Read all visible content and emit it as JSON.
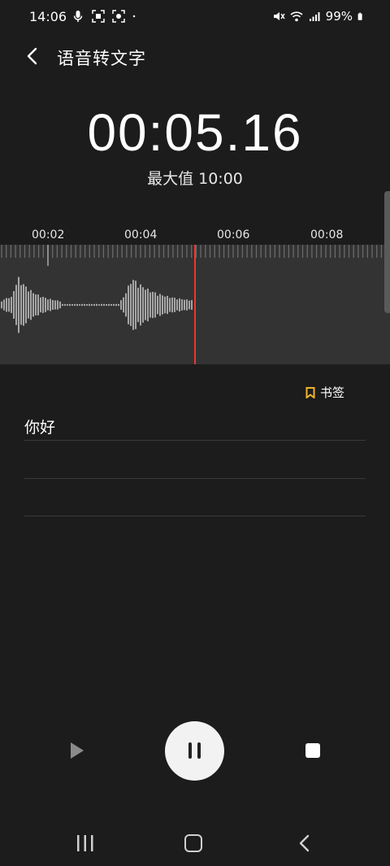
{
  "status_bar": {
    "time": "14:06",
    "battery": "99%",
    "left_icons": [
      "mic-icon",
      "screen-capture-icon",
      "screen-record-icon",
      "dot-icon"
    ],
    "right_icons": [
      "mute-icon",
      "wifi-icon",
      "signal-icon",
      "battery-icon"
    ]
  },
  "app_bar": {
    "title": "语音转文字",
    "back_icon": "chevron-left-icon"
  },
  "recorder": {
    "elapsed": "00:05.16",
    "max_label": "最大值 10:00"
  },
  "timeline": {
    "labels": [
      "00:02",
      "00:04",
      "00:06",
      "00:08"
    ]
  },
  "bookmark": {
    "label": "书签",
    "icon": "bookmark-icon",
    "color": "#f0b429"
  },
  "transcript": {
    "lines": [
      "你好",
      "",
      ""
    ]
  },
  "controls": {
    "play_icon": "play-icon",
    "pause_icon": "pause-icon",
    "stop_icon": "stop-icon"
  },
  "colors": {
    "background": "#1c1c1c",
    "wave_panel": "#333333",
    "playhead": "#e53935"
  },
  "nav_bar": {
    "icons": [
      "recents-icon",
      "home-icon",
      "back-icon"
    ]
  }
}
